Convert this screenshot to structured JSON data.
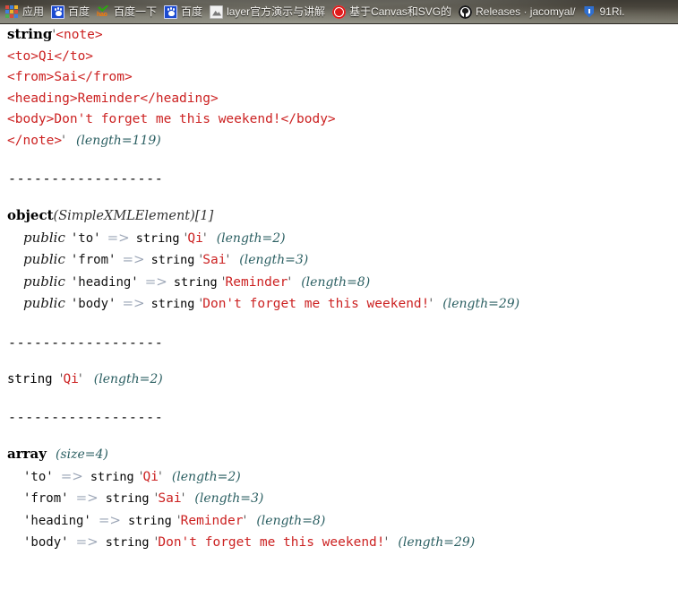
{
  "bookmarks_bar": {
    "items": [
      {
        "icon": "apps-grid-icon",
        "label": "应用"
      },
      {
        "icon": "baidu-paw-icon",
        "label": "百度"
      },
      {
        "icon": "hao123-check-icon",
        "label": "百度一下"
      },
      {
        "icon": "baidu-paw-icon",
        "label": "百度"
      },
      {
        "icon": "layer-mountain-icon",
        "label": "layer官方演示与讲解"
      },
      {
        "icon": "red-circle-icon",
        "label": "基于Canvas和SVG的"
      },
      {
        "icon": "github-mark-icon",
        "label": "Releases · jacomyal/"
      },
      {
        "icon": "blue-shield-icon",
        "label": "91Ri."
      }
    ]
  },
  "colors": {
    "page_background": "#ffffff",
    "string_value": "#cc2222",
    "length_annotation": "#2b5f62",
    "arrow": "#9aa4b5",
    "type_keyword": "#000000",
    "bookmarks_bar": "#4a463d"
  },
  "dump": {
    "separator": "------------------",
    "blocks": [
      {
        "id": "xml-string-dump",
        "type_label": "string",
        "open_quote": "'",
        "close_quote": "'",
        "length": "(length=119)",
        "xml_lines": [
          "<note>",
          "<to>Qi</to>",
          "<from>Sai</from>",
          "<heading>Reminder</heading>",
          "<body>Don't forget me this weekend!</body>",
          "</note>"
        ]
      },
      {
        "id": "simplexmlelement-object-dump",
        "type_label": "object",
        "class_name": "(SimpleXMLElement)",
        "object_id": "[1]",
        "properties": [
          {
            "visibility": "public",
            "key": "'to'",
            "arrow": "=>",
            "type_label": "string",
            "value": "Qi",
            "length": "(length=2)"
          },
          {
            "visibility": "public",
            "key": "'from'",
            "arrow": "=>",
            "type_label": "string",
            "value": "Sai",
            "length": "(length=3)"
          },
          {
            "visibility": "public",
            "key": "'heading'",
            "arrow": "=>",
            "type_label": "string",
            "value": "Reminder",
            "length": "(length=8)"
          },
          {
            "visibility": "public",
            "key": "'body'",
            "arrow": "=>",
            "type_label": "string",
            "value": "Don't forget me this weekend!",
            "length": "(length=29)"
          }
        ]
      },
      {
        "id": "scalar-string-dump",
        "type_label": "string",
        "value": "Qi",
        "length": "(length=2)"
      },
      {
        "id": "array-dump",
        "type_label": "array",
        "size": "(size=4)",
        "entries": [
          {
            "key": "'to'",
            "arrow": "=>",
            "type_label": "string",
            "value": "Qi",
            "length": "(length=2)"
          },
          {
            "key": "'from'",
            "arrow": "=>",
            "type_label": "string",
            "value": "Sai",
            "length": "(length=3)"
          },
          {
            "key": "'heading'",
            "arrow": "=>",
            "type_label": "string",
            "value": "Reminder",
            "length": "(length=8)"
          },
          {
            "key": "'body'",
            "arrow": "=>",
            "type_label": "string",
            "value": "Don't forget me this weekend!",
            "length": "(length=29)"
          }
        ]
      }
    ]
  }
}
